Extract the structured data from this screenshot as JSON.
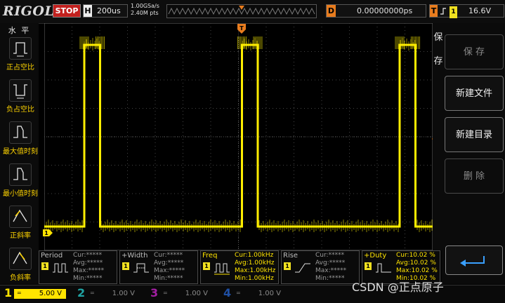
{
  "topbar": {
    "logo": "RIGOL",
    "run_state": "STOP",
    "timebase_label": "H",
    "timebase_value": "200us",
    "sample_rate": "1.00GSa/s",
    "mem_depth": "2.40M pts",
    "delay_label": "D",
    "delay_value": "0.00000000ps",
    "trigger_label": "T",
    "trigger_channel": "1",
    "trigger_level": "16.6V"
  },
  "left_menu": {
    "title": "水 平",
    "items": [
      {
        "label": "正占空比",
        "icon": "positive-duty-icon"
      },
      {
        "label": "负占空比",
        "icon": "negative-duty-icon"
      },
      {
        "label": "最大值时刻",
        "icon": "max-time-icon"
      },
      {
        "label": "最小值时刻",
        "icon": "min-time-icon"
      },
      {
        "label": "正斜率",
        "icon": "positive-slope-icon"
      },
      {
        "label": "负斜率",
        "icon": "negative-slope-icon"
      }
    ]
  },
  "right_menu": {
    "title_chars": [
      "保",
      "存"
    ],
    "buttons": [
      {
        "label": "保 存",
        "enabled": false
      },
      {
        "label": "新建文件",
        "enabled": true
      },
      {
        "label": "新建目录",
        "enabled": true
      },
      {
        "label": "删 除",
        "enabled": false
      }
    ],
    "enter_icon": "enter-arrow-icon"
  },
  "markers": {
    "trigger_edge": "T",
    "channel1_ground": "1"
  },
  "waveform": {
    "channel": "1",
    "color": "#ffee00",
    "duty_cycle_percent": 10.02,
    "frequency_khz": 1.0
  },
  "measurements": [
    {
      "name": "Period",
      "lines": [
        "Cur:*****",
        "Avg:*****",
        "Max:*****",
        "Min:*****"
      ],
      "active": false,
      "icon": "period-icon"
    },
    {
      "name": "+Width",
      "lines": [
        "Cur:*****",
        "Avg:*****",
        "Max:*****",
        "Min:*****"
      ],
      "active": false,
      "icon": "pulse-width-icon"
    },
    {
      "name": "Freq",
      "lines": [
        "Cur:1.00kHz",
        "Avg:1.00kHz",
        "Max:1.00kHz",
        "Min:1.00kHz"
      ],
      "active": true,
      "icon": "frequency-icon"
    },
    {
      "name": "Rise",
      "lines": [
        "Cur:*****",
        "Avg:*****",
        "Max:*****",
        "Min:*****"
      ],
      "active": false,
      "icon": "rise-time-icon"
    },
    {
      "name": "+Duty",
      "lines": [
        "Cur:10.02 %",
        "Avg:10.02 %",
        "Max:10.02 %",
        "Min:10.02 %"
      ],
      "active": true,
      "icon": "duty-icon"
    }
  ],
  "channels": [
    {
      "num": "1",
      "coupling": "=",
      "scale": "5.00 V",
      "color": "#ffe400",
      "active": true
    },
    {
      "num": "2",
      "coupling": "=",
      "scale": "1.00 V",
      "color": "#1fa3a3",
      "active": false
    },
    {
      "num": "3",
      "coupling": "=",
      "scale": "1.00 V",
      "color": "#a31fa3",
      "active": false
    },
    {
      "num": "4",
      "coupling": "=",
      "scale": "1.00 V",
      "color": "#1f4fa3",
      "active": false
    }
  ],
  "watermark": "CSDN @正点原子"
}
